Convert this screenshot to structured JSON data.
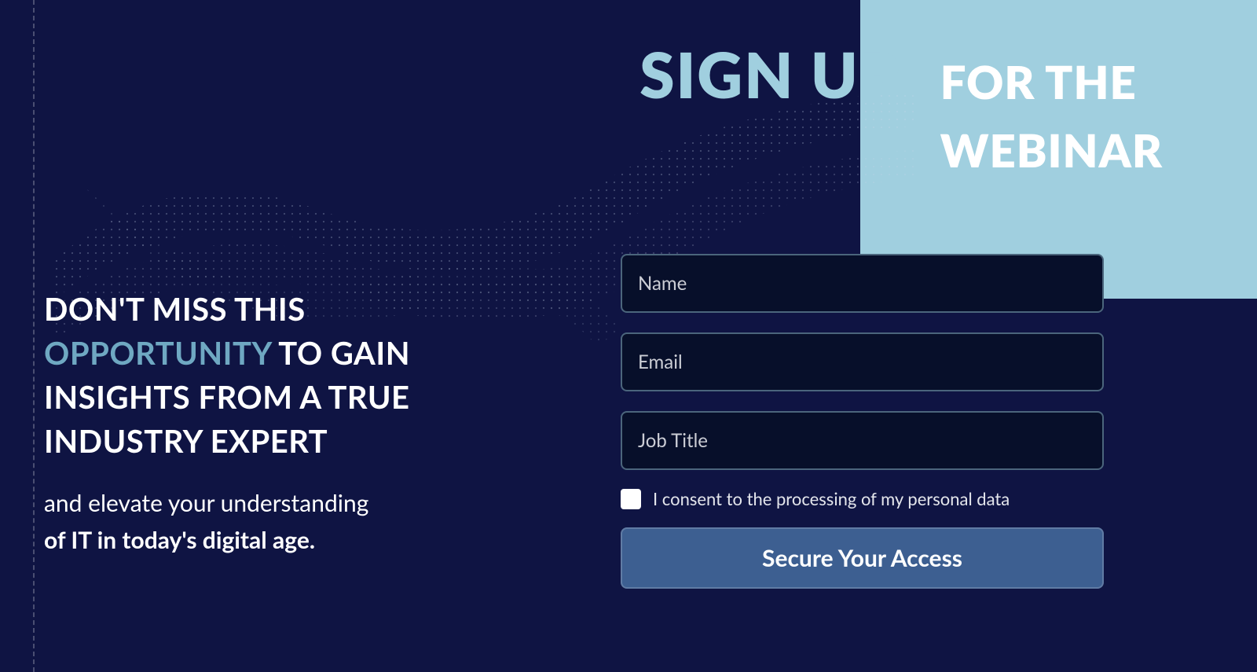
{
  "heading": {
    "signup": "SIGN UP",
    "for_the_webinar_line1": "FOR THE",
    "for_the_webinar_line2": "WEBINAR"
  },
  "copy": {
    "line1": "DON'T MISS THIS",
    "highlight": "OPPORTUNITY",
    "line2_rest": " TO GAIN",
    "line3": "INSIGHTS FROM A TRUE",
    "line4": "INDUSTRY EXPERT",
    "sub1": "and elevate your understanding",
    "sub2": "of IT in today's digital age."
  },
  "form": {
    "name_placeholder": "Name",
    "email_placeholder": "Email",
    "job_title_placeholder": "Job Title",
    "consent_label": "I consent to the processing of my personal data",
    "submit_label": "Secure Your Access"
  },
  "colors": {
    "bg": "#0f1443",
    "accent_box": "#a0cfdf",
    "input_bg": "#070f2a",
    "button": "#3d5f91",
    "highlight": "#6fa8c2"
  }
}
